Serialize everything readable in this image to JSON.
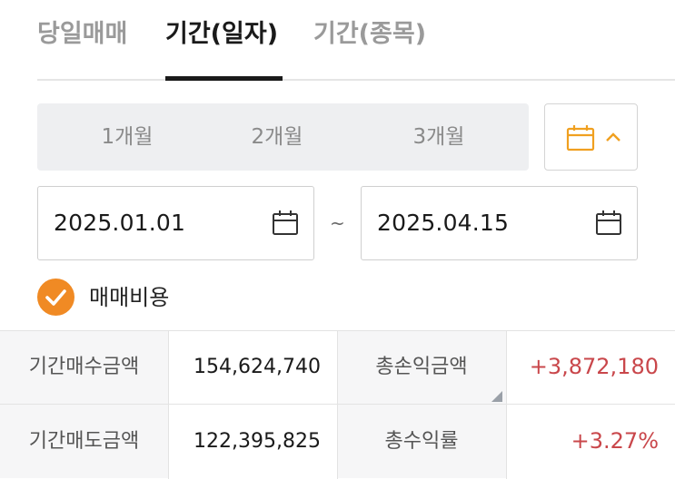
{
  "tabs": [
    {
      "label": "당일매매",
      "active": false
    },
    {
      "label": "기간(일자)",
      "active": true
    },
    {
      "label": "기간(종목)",
      "active": false
    }
  ],
  "period_buttons": [
    "1개월",
    "2개월",
    "3개월"
  ],
  "calendar_toggle": {
    "icon": "calendar-icon",
    "chevron": "chevron-up-icon",
    "expanded": true,
    "accent": "#f0a020"
  },
  "date_range": {
    "start": "2025.01.01",
    "separator": "~",
    "end": "2025.04.15"
  },
  "fee_option": {
    "label": "매매비용",
    "checked": true,
    "color": "#f08a24"
  },
  "summary": {
    "buy_label": "기간매수금액",
    "buy_value": "154,624,740",
    "pnl_label": "총손익금액",
    "pnl_value": "+3,872,180",
    "sell_label": "기간매도금액",
    "sell_value": "122,395,825",
    "return_label": "총수익률",
    "return_value": "+3.27%"
  },
  "colors": {
    "positive": "#c9474b",
    "accent": "#f08a24"
  }
}
